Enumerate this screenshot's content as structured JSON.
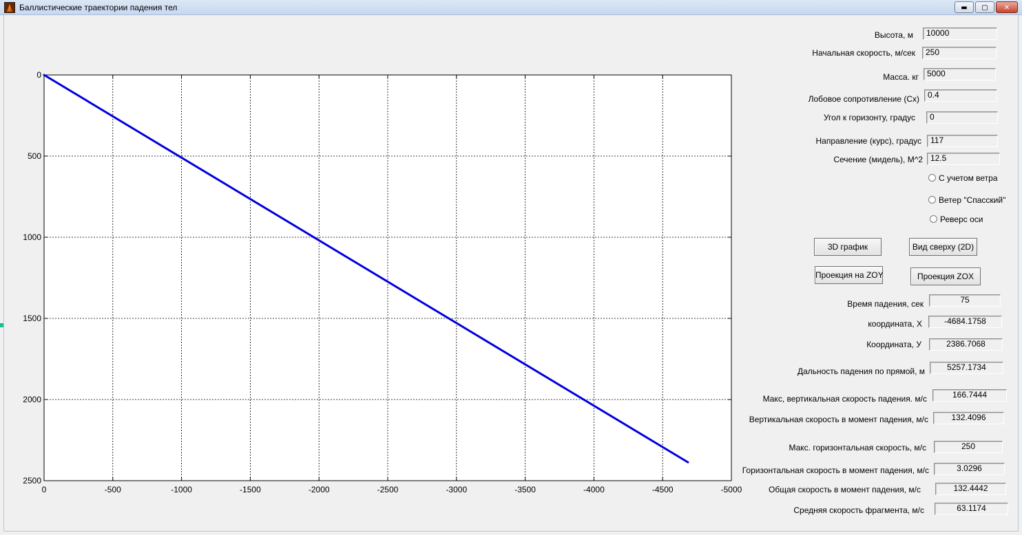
{
  "window": {
    "title": "Баллистические траектории падения тел",
    "minimize_glyph": "▬",
    "maximize_glyph": "▢",
    "close_glyph": "✕"
  },
  "inputs": [
    {
      "label": "Высота, м",
      "value": "10000"
    },
    {
      "label": "Начальная скорость, м/сек",
      "value": "250"
    },
    {
      "label": "Масса. кг",
      "value": "5000"
    },
    {
      "label": "Лобовое сопротивление (Cx)",
      "value": "0.4"
    },
    {
      "label": "Угол к горизонту, градус",
      "value": "0"
    },
    {
      "label": "Направление  (курс), градус",
      "value": "117"
    },
    {
      "label": "Сечение (мидель), М^2",
      "value": "12.5"
    }
  ],
  "options": [
    {
      "label": "С учетом ветра"
    },
    {
      "label": "Ветер \"Спасский\""
    },
    {
      "label": "Реверс оси"
    }
  ],
  "buttons": {
    "plot3d": "3D график",
    "top_view": "Вид сверху (2D)",
    "proj_zoy": "Проекция на ZOY",
    "proj_zox": "Проекция ZOX"
  },
  "outputs": [
    {
      "label": "Время падения, сек",
      "value": "75"
    },
    {
      "label": "координата, X",
      "value": "-4684.1758"
    },
    {
      "label": "Координата, У",
      "value": "2386.7068"
    },
    {
      "label": "Дальность падения по прямой, м",
      "value": "5257.1734"
    },
    {
      "label": "Макс,  вертикальная скорость падения. м/с",
      "value": "166.7444"
    },
    {
      "label": "Вертикальная  скорость в момент падения, м/с",
      "value": "132.4096"
    },
    {
      "label": "Макс. горизонтальная скорость, м/с",
      "value": "250"
    },
    {
      "label": "Горизонтальная скорость в момент падения, м/с",
      "value": "3.0296"
    },
    {
      "label": "Общая скорость в момент падения, м/с",
      "value": "132.4442"
    },
    {
      "label": "Средняя скорость фрагмента, м/с",
      "value": "63.1174"
    }
  ],
  "chart_data": {
    "type": "line",
    "x_ticks": [
      "0",
      "-500",
      "-1000",
      "-1500",
      "-2000",
      "-2500",
      "-3000",
      "-3500",
      "-4000",
      "-4500",
      "-5000"
    ],
    "y_ticks": [
      "0",
      "500",
      "1000",
      "1500",
      "2000",
      "2500"
    ],
    "xlim": [
      0,
      -5000
    ],
    "ylim": [
      0,
      2500
    ],
    "y_reversed": true,
    "grid": true,
    "grid_style": "dashed",
    "line_color": "#0000dd",
    "series": [
      {
        "x": [
          0,
          -4684.1758
        ],
        "y": [
          0,
          2386.7068
        ]
      }
    ]
  }
}
